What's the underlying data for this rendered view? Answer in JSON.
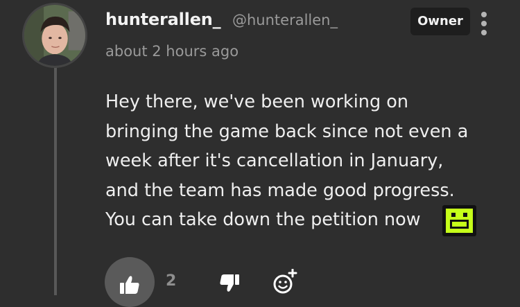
{
  "comment": {
    "username": "hunterallen_",
    "handle": "@hunterallen_",
    "timestamp": "about 2 hours ago",
    "badge": "Owner",
    "message": "Hey there, we've been working on\nbringing the game back since not even a\nweek after it's cancellation in January,\nand the team has made good progress.\nYou can take down the petition now",
    "emoji": "green-smiley-face-emoji",
    "like_count": "2"
  },
  "colors": {
    "background": "#2e2e2e",
    "text_primary": "#efefef",
    "text_secondary": "#9a9a9a",
    "badge_background": "#1e1e1e",
    "like_button_background": "#5a5a5a",
    "emoji_green": "#c6ff1a"
  },
  "icons": {
    "more": "more-vertical-icon",
    "like": "thumbs-up-icon",
    "dislike": "thumbs-down-icon",
    "react": "add-reaction-icon"
  }
}
